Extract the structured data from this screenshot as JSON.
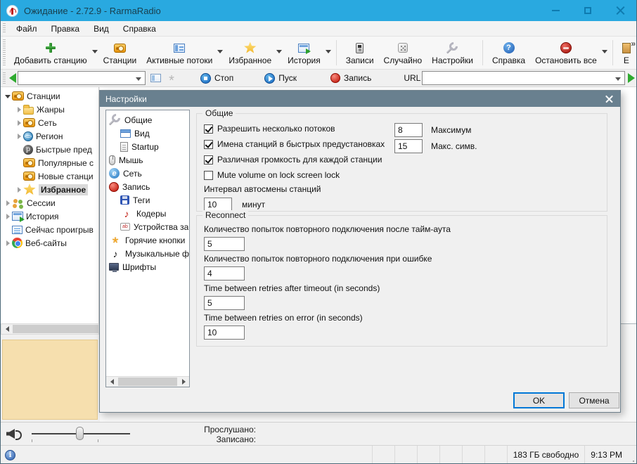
{
  "window": {
    "title": "Ожидание - 2.72.9 - RarmaRadio"
  },
  "menu": {
    "items": [
      {
        "label": "Файл"
      },
      {
        "label": "Правка"
      },
      {
        "label": "Вид"
      },
      {
        "label": "Справка"
      }
    ]
  },
  "toolbar": {
    "overflow_chevron": "»",
    "buttons": [
      {
        "label": "Добавить станцию",
        "icon": "plus-icon",
        "dropdown": true
      },
      {
        "label": "Станции",
        "icon": "radio-icon"
      },
      {
        "label": "Активные потоки",
        "icon": "streams-icon",
        "dropdown": true
      },
      {
        "label": "Избранное",
        "icon": "star-icon",
        "dropdown": true
      },
      {
        "label": "История",
        "icon": "history-icon",
        "dropdown": true
      },
      {
        "sep": true
      },
      {
        "label": "Записи",
        "icon": "recorder-icon"
      },
      {
        "label": "Случайно",
        "icon": "dice-icon"
      },
      {
        "label": "Настройки",
        "icon": "wrench-icon"
      },
      {
        "sep": true
      },
      {
        "label": "Справка",
        "icon": "help-icon"
      },
      {
        "label": "Остановить все",
        "icon": "stop-all-icon",
        "dropdown": true
      },
      {
        "sep": true
      },
      {
        "label": "E",
        "icon": "exit-icon"
      }
    ]
  },
  "toolbar2": {
    "station_combo_value": "",
    "stop_label": "Стоп",
    "start_label": "Пуск",
    "record_label": "Запись",
    "url_label": "URL",
    "url_combo_value": ""
  },
  "sidebar": {
    "items": [
      {
        "label": "Станции",
        "icon": "radio-icon",
        "depth": 0,
        "expander": "open"
      },
      {
        "label": "Жанры",
        "icon": "folder-icon",
        "depth": 1,
        "expander": "closed"
      },
      {
        "label": "Сеть",
        "icon": "radio-icon",
        "depth": 1,
        "expander": "closed"
      },
      {
        "label": "Регион",
        "icon": "globe-icon",
        "depth": 1,
        "expander": "closed"
      },
      {
        "label": "Быстрые пред",
        "icon": "preset-p-icon",
        "depth": 1,
        "expander": "none"
      },
      {
        "label": "Популярные с",
        "icon": "radio-icon",
        "depth": 1,
        "expander": "none"
      },
      {
        "label": "Новые станци",
        "icon": "radio-icon",
        "depth": 1,
        "expander": "none"
      },
      {
        "label": "Избранное",
        "icon": "star-icon",
        "depth": 1,
        "expander": "closed",
        "selected": true
      },
      {
        "label": "Сессии",
        "icon": "sessions-icon",
        "depth": 0,
        "expander": "closed"
      },
      {
        "label": "История",
        "icon": "history-icon",
        "depth": 0,
        "expander": "closed"
      },
      {
        "label": "Сейчас проигрыв",
        "icon": "now-playing-icon",
        "depth": 0,
        "expander": "none"
      },
      {
        "label": "Веб-сайты",
        "icon": "websites-icon",
        "depth": 0,
        "expander": "closed"
      }
    ]
  },
  "dialog": {
    "title": "Настройки",
    "nav": [
      {
        "label": "Общие",
        "icon": "wrench-icon",
        "depth": 0
      },
      {
        "label": "Вид",
        "icon": "view-icon",
        "depth": 1
      },
      {
        "label": "Startup",
        "icon": "startup-icon",
        "depth": 1
      },
      {
        "label": "Мышь",
        "icon": "mouse-icon",
        "depth": 0
      },
      {
        "label": "Сеть",
        "icon": "network-icon",
        "depth": 0
      },
      {
        "label": "Запись",
        "icon": "record-ball-icon",
        "depth": 0
      },
      {
        "label": "Теги",
        "icon": "tags-icon",
        "depth": 1
      },
      {
        "label": "Кодеры",
        "icon": "encoders-icon",
        "depth": 1
      },
      {
        "label": "Устройства за",
        "icon": "devices-icon",
        "depth": 1
      },
      {
        "label": "Горячие кнопки",
        "icon": "hotkeys-icon",
        "depth": 0
      },
      {
        "label": "Музыкальные фа",
        "icon": "music-icon",
        "depth": 0
      },
      {
        "label": "Шрифты",
        "icon": "fonts-icon",
        "depth": 0
      }
    ],
    "general_group": {
      "title": "Общие",
      "checkboxes": [
        {
          "label": "Разрешить несколько потоков",
          "checked": true
        },
        {
          "label": "Имена станций в быстрых предустановках",
          "checked": true
        },
        {
          "label": "Различная громкость для каждой станции",
          "checked": true
        },
        {
          "label": "Mute volume on lock screen lock",
          "checked": false
        }
      ],
      "side_fields": [
        {
          "value": "8",
          "label": "Максимум"
        },
        {
          "value": "15",
          "label": "Макс. симв."
        }
      ],
      "interval_label": "Интервал автосмены станций",
      "interval_value": "10",
      "interval_unit": "минут"
    },
    "reconnect_group": {
      "title": "Reconnect",
      "fields": [
        {
          "label": "Количество попыток повторного подключения после тайм-аута",
          "value": "5"
        },
        {
          "label": "Количество попыток повторного подключения при ошибке",
          "value": "4"
        },
        {
          "label": "Time between retries after timeout (in seconds)",
          "value": "5"
        },
        {
          "label": "Time between retries on error (in seconds)",
          "value": "10"
        }
      ]
    },
    "ok_label": "OK",
    "cancel_label": "Отмена"
  },
  "player": {
    "listened_label": "Прослушано:",
    "recorded_label": "Записано:"
  },
  "statusbar": {
    "free_space": "183 ГБ свободно",
    "time": "9:13 PM"
  }
}
